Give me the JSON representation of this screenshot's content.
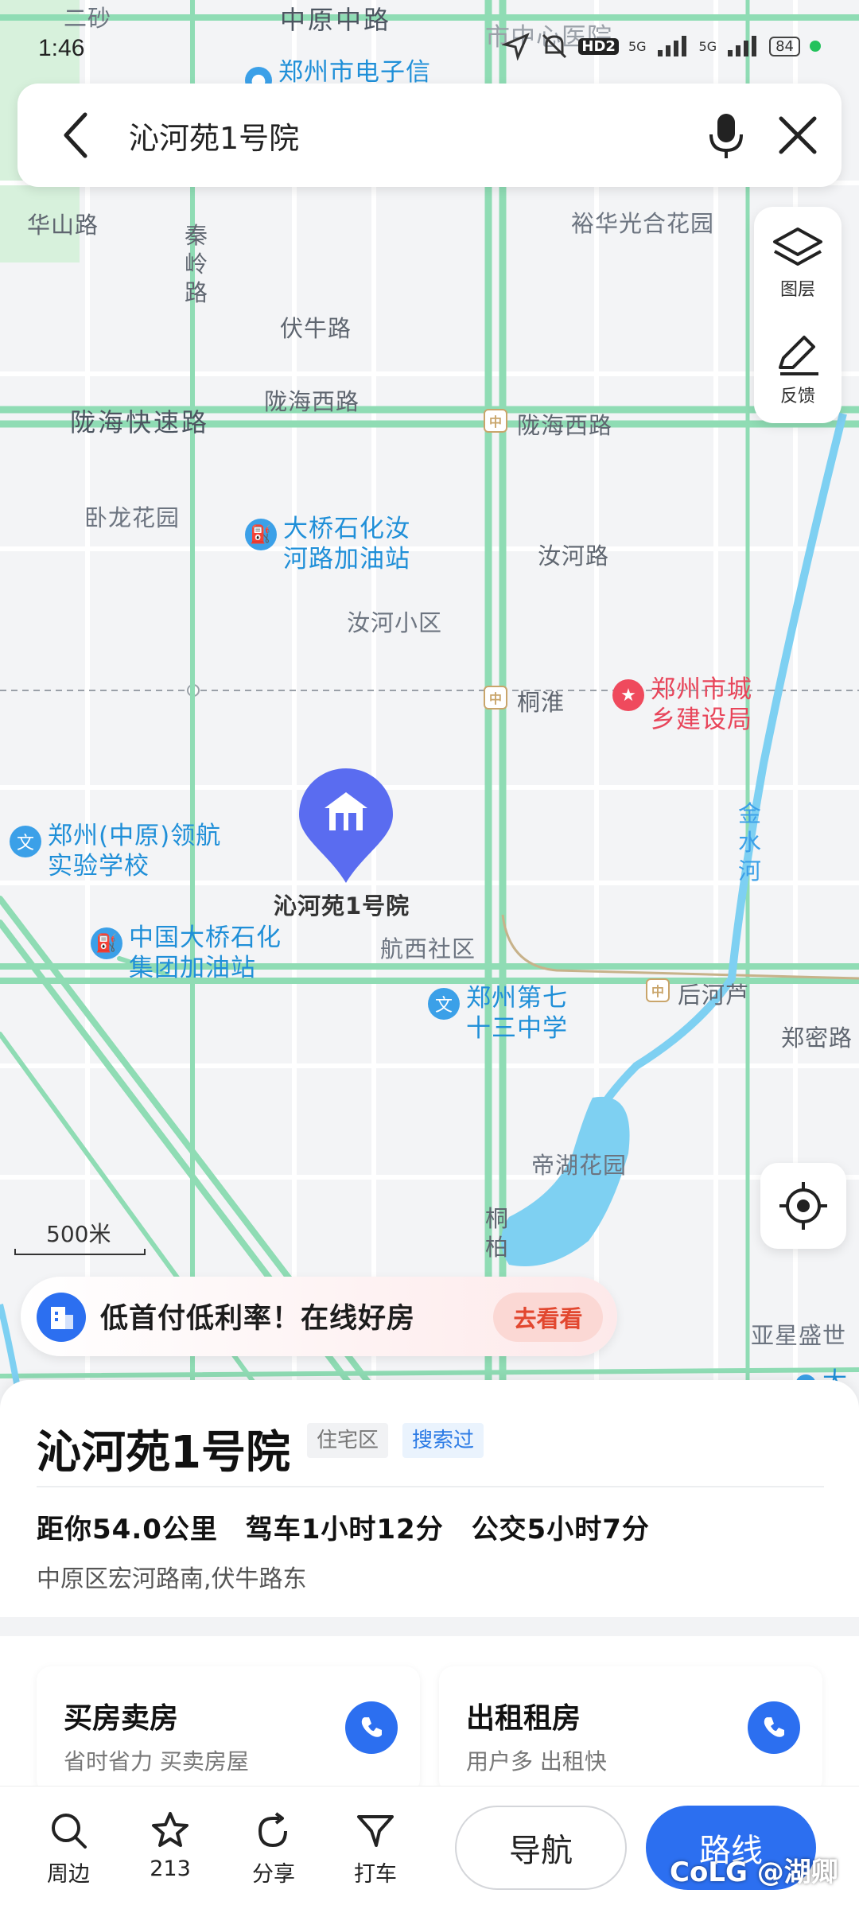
{
  "status": {
    "time": "1:46",
    "signal1": "5G",
    "signal2": "5G",
    "hd": "HD2",
    "battery": "84"
  },
  "search": {
    "query": "沁河苑1号院"
  },
  "tools": {
    "layers": "图层",
    "feedback": "反馈"
  },
  "map": {
    "roads": {
      "zhongyuan": "中原中路",
      "erSha": "二砂",
      "huashan": "华山路",
      "qinling": "秦岭路",
      "funiu": "伏牛路",
      "longhaiExpress": "陇海快速路",
      "longhaiWest1": "陇海西路",
      "longhaiWest2": "陇海西路",
      "ruhe": "汝河路",
      "tongbai": "桐柏",
      "zhengmi": "郑密路"
    },
    "areas": {
      "yuhua": "裕华光合花园",
      "wolong": "卧龙花园",
      "ruheXiaoqu": "汝河小区",
      "hangxi": "航西社区",
      "dihu": "帝湖花园",
      "yaxing": "亚星盛世",
      "jinshui": "金水河"
    },
    "subways": {
      "tonghuai": "桐淮",
      "houhelu": "后河芦"
    },
    "pois": {
      "elec": "郑州市电子信",
      "hospital": "市中心医院",
      "gas1": "大桥石化汝河路加油站",
      "gas2": "中国大桥石化集团加油站",
      "school1": "郑州(中原)领航实验学校",
      "school2": "郑州第七十三中学",
      "urbanBureau": "郑州市城乡建设局",
      "partial": "大"
    },
    "marker": {
      "label": "沁河苑1号院"
    },
    "scale": "500米"
  },
  "promo": {
    "text": "低首付低利率！在线好房",
    "button": "去看看"
  },
  "place": {
    "title": "沁河苑1号院",
    "tag_type": "住宅区",
    "tag_searched": "搜索过",
    "distance": "距你54.0公里",
    "drive": "驾车1小时12分",
    "bus": "公交5小时7分",
    "address": "中原区宏河路南,伏牛路东"
  },
  "cards": [
    {
      "title": "买房卖房",
      "subtitle": "省时省力 买卖房屋"
    },
    {
      "title": "出租租房",
      "subtitle": "用户多 出租快"
    }
  ],
  "nav": {
    "nearby": "周边",
    "favorites": "213",
    "share": "分享",
    "taxi": "打车",
    "navigate": "导航",
    "route": "路线"
  },
  "watermark": "CoLG @湖卿",
  "colors": {
    "accent": "#2c6ff0",
    "road": "#8fdcb4",
    "water": "#7ed0f2",
    "marker": "#5a6cf0"
  }
}
